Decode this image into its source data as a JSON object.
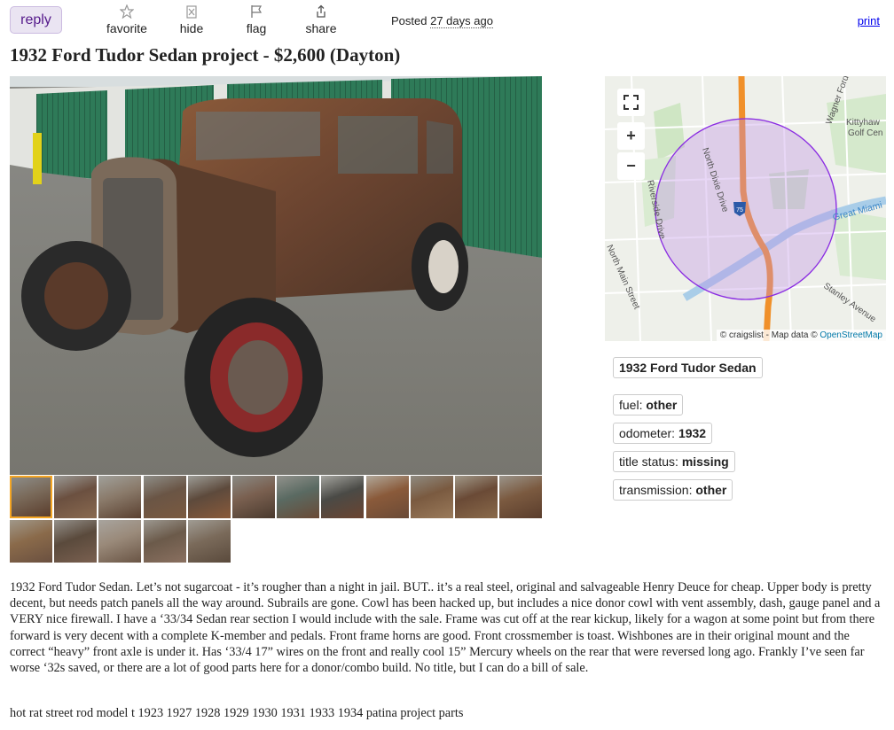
{
  "actions": {
    "reply": "reply",
    "favorite": "favorite",
    "hide": "hide",
    "flag": "flag",
    "share": "share",
    "posted_label": "Posted",
    "posted_ago": "27 days ago",
    "print": "print"
  },
  "title": "1932 Ford Tudor Sedan project - $2,600 (Dayton)",
  "map": {
    "credit_prefix": "© craigslist - Map data ©",
    "credit_link": "OpenStreetMap",
    "labels": {
      "golf": "Kittyhaw Golf Cen",
      "wagner": "Wagner Ford",
      "north_dixie": "North Dixie Drive",
      "riverside": "Riverside Drive",
      "great_miami": "Great Miami",
      "north_main": "North Main Street",
      "stanley": "Stanley Avenue",
      "interstate": "75"
    },
    "zoom_in": "+",
    "zoom_out": "−"
  },
  "attributes": {
    "model": "1932 Ford Tudor Sedan",
    "fuel_label": "fuel:",
    "fuel_value": "other",
    "odometer_label": "odometer:",
    "odometer_value": "1932",
    "title_status_label": "title status:",
    "title_status_value": "missing",
    "transmission_label": "transmission:",
    "transmission_value": "other"
  },
  "description": "1932 Ford Tudor Sedan. Let’s not sugarcoat - it’s rougher than a night in jail. BUT.. it’s a real steel, original and salvageable Henry Deuce for cheap. Upper body is pretty decent, but needs patch panels all the way around. Subrails are gone. Cowl has been hacked up, but includes a nice donor cowl with vent assembly, dash, gauge panel and a VERY nice firewall. I have a ‘33/34 Sedan rear section I would include with the sale. Frame was cut off at the rear kickup, likely for a wagon at some point but from there forward is very decent with a complete K-member and pedals. Front frame horns are good. Front crossmember is toast. Wishbones are in their original mount and the correct “heavy” front axle is under it. Has ‘33/4 17” wires on the front and really cool 15” Mercury wheels on the rear that were reversed long ago. Frankly I’ve seen far worse ‘32s saved, or there are a lot of good parts here for a donor/combo build. No title, but I can do a bill of sale.",
  "tags": "hot rat street rod model t 1923 1927 1928 1929 1930 1931 1933 1934 patina project parts",
  "colors": {
    "reply_bg": "#eae4f2",
    "reply_text": "#551a8b",
    "link": "#0000ee",
    "thumb_selected": "#f5a623",
    "map_radius": "#8a2be2",
    "highway": "#f0902a"
  },
  "thumbnails": [
    "thumb-1",
    "thumb-2",
    "thumb-3",
    "thumb-4",
    "thumb-5",
    "thumb-6",
    "thumb-7",
    "thumb-8",
    "thumb-9",
    "thumb-10",
    "thumb-11",
    "thumb-12",
    "thumb-13",
    "thumb-14",
    "thumb-15",
    "thumb-16",
    "thumb-17"
  ]
}
